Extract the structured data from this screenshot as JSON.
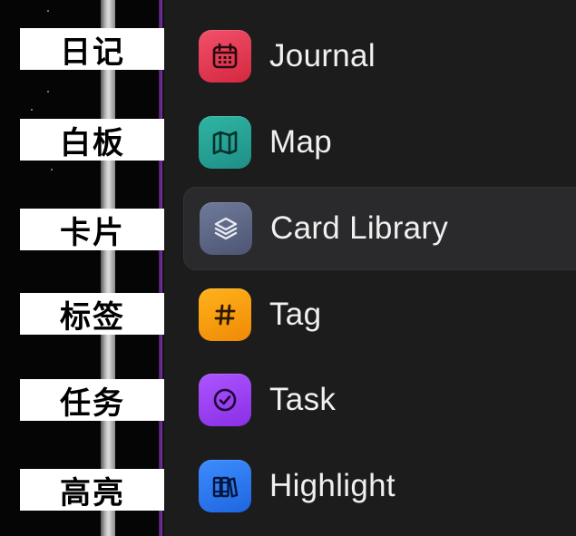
{
  "captions": [
    "日记",
    "白板",
    "卡片",
    "标签",
    "任务",
    "高亮"
  ],
  "menu": {
    "items": [
      {
        "label": "Journal",
        "icon": "calendar-icon",
        "color": "#e23a57"
      },
      {
        "label": "Map",
        "icon": "map-icon",
        "color": "#2aa198"
      },
      {
        "label": "Card Library",
        "icon": "layers-icon",
        "color": "#5d6686",
        "active": true
      },
      {
        "label": "Tag",
        "icon": "hash-icon",
        "color": "#f59a0c"
      },
      {
        "label": "Task",
        "icon": "check-circle-icon",
        "color": "#9b3ff0"
      },
      {
        "label": "Highlight",
        "icon": "books-icon",
        "color": "#2e7cf6"
      }
    ]
  },
  "colors": {
    "panel_background": "#1c1c1d",
    "active_item_background": "#2a2a2c",
    "caption_background": "#ffffff"
  }
}
